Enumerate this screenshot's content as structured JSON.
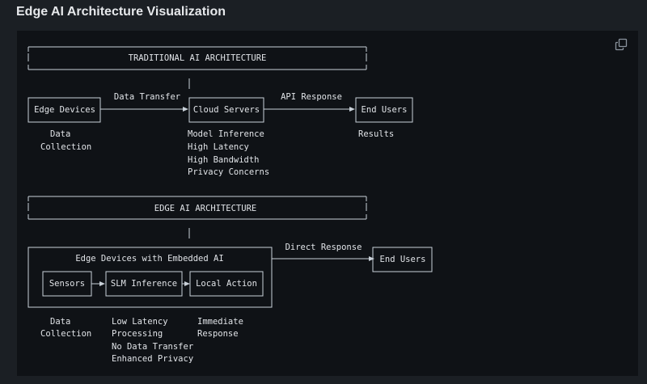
{
  "page": {
    "title": "Edge AI Architecture Visualization"
  },
  "toolbar": {
    "copy_icon": "copy-icon"
  },
  "colors": {
    "background": "#1b1f24",
    "panel": "#0f1216",
    "lines": "#c9d1d9",
    "text": "#e1e4e8"
  },
  "traditional": {
    "header": "TRADITIONAL AI ARCHITECTURE",
    "edge_devices": "Edge Devices",
    "cloud_servers": "Cloud Servers",
    "end_users": "End Users",
    "data_transfer": "Data Transfer",
    "api_response": "API Response",
    "edge_notes": [
      "Data",
      "Collection"
    ],
    "cloud_notes": [
      "Model Inference",
      "High Latency",
      "High Bandwidth",
      "Privacy Concerns"
    ],
    "user_notes": [
      "Results"
    ]
  },
  "edge": {
    "header": "EDGE AI ARCHITECTURE",
    "container_title": "Edge Devices with Embedded AI",
    "sensors": "Sensors",
    "slm_inference": "SLM Inference",
    "local_action": "Local Action",
    "direct_response": "Direct Response",
    "end_users": "End Users",
    "sensor_notes": [
      "Data",
      "Collection"
    ],
    "inference_notes": [
      "Low Latency",
      "Processing",
      "No Data Transfer",
      "Enhanced Privacy"
    ],
    "action_notes": [
      "Immediate",
      "Response"
    ]
  }
}
